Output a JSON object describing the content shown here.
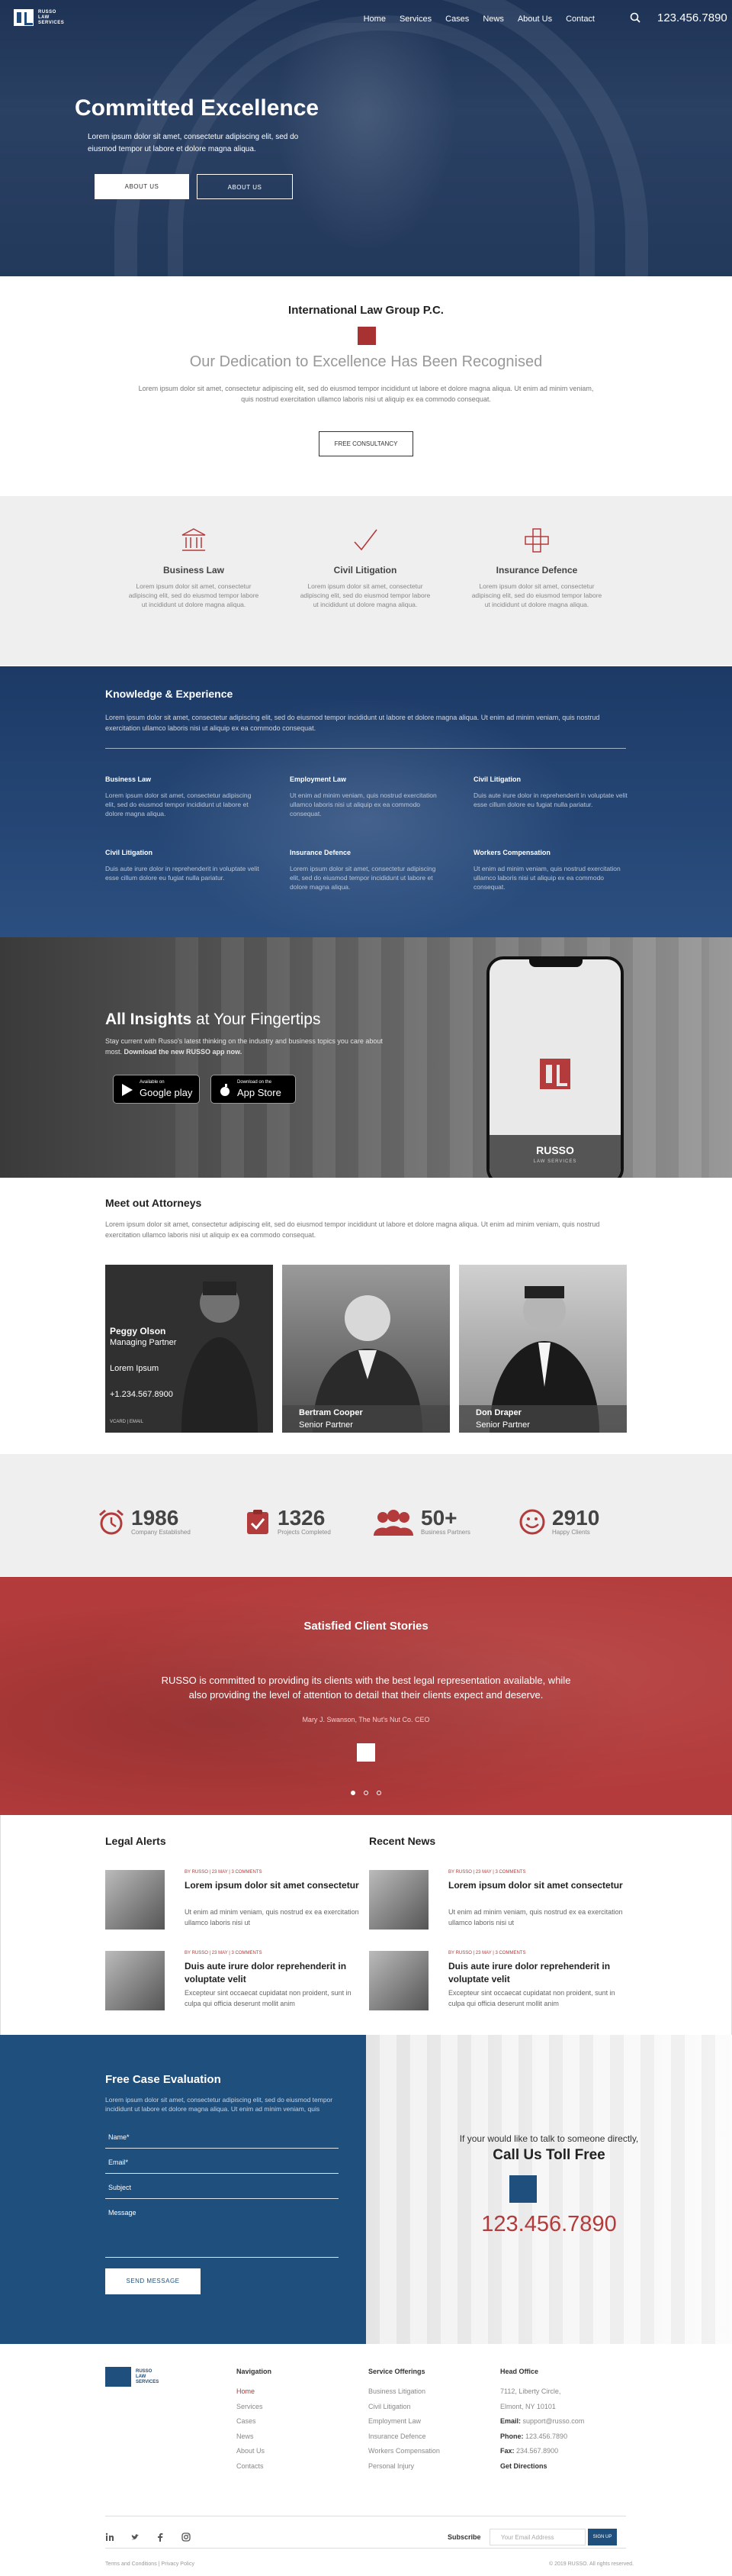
{
  "brand": {
    "logo_text": "RUSSO\nLAW\nSERVICES"
  },
  "nav": {
    "items": [
      "Home",
      "Services",
      "Cases",
      "News",
      "About Us",
      "Contact"
    ],
    "phone": "123.456.7890"
  },
  "hero": {
    "title": "Committed Excellence",
    "subtitle": "Lorem ipsum dolor sit amet, consectetur adipiscing elit, sed do eiusmod tempor ut labore et dolore magna aliqua.",
    "btn_primary": "ABOUT US",
    "btn_secondary": "ABOUT US"
  },
  "intro": {
    "heading": "International Law Group P.C.",
    "title": "Our Dedication to Excellence Has Been Recognised",
    "text": "Lorem ipsum dolor sit amet, consectetur adipiscing elit, sed do eiusmod tempor incididunt ut labore et dolore magna aliqua. Ut enim ad minim veniam, quis nostrud exercitation ullamco laboris nisi ut aliquip ex ea commodo consequat.",
    "button": "FREE CONSULTANCY"
  },
  "practice": [
    {
      "icon": "bank-icon",
      "title": "Business Law",
      "text": "Lorem ipsum dolor sit amet, consectetur adipiscing elit, sed do eiusmod tempor labore ut incididunt ut dolore magna aliqua."
    },
    {
      "icon": "checkmark-icon",
      "title": "Civil Litigation",
      "text": "Lorem ipsum dolor sit amet, consectetur adipiscing elit, sed do eiusmod tempor labore ut incididunt ut dolore magna aliqua."
    },
    {
      "icon": "insurance-cross-icon",
      "title": "Insurance Defence",
      "text": "Lorem ipsum dolor sit amet, consectetur adipiscing elit, sed do eiusmod tempor labore ut incididunt ut dolore magna aliqua."
    }
  ],
  "knowledge": {
    "title": "Knowledge & Experience",
    "desc": "Lorem ipsum dolor sit amet, consectetur adipiscing elit, sed do eiusmod tempor incididunt ut labore et dolore magna aliqua. Ut enim ad minim veniam, quis nostrud exercitation ullamco laboris nisi ut aliquip ex ea commodo consequat.",
    "items": [
      {
        "title": "Business Law",
        "text": "Lorem ipsum dolor sit amet, consectetur adipiscing elit, sed do eiusmod tempor incididunt ut labore et dolore magna aliqua."
      },
      {
        "title": "Employment Law",
        "text": "Ut enim ad minim veniam, quis nostrud exercitation ullamco laboris nisi ut aliquip ex ea commodo consequat."
      },
      {
        "title": "Civil Litigation",
        "text": "Duis aute irure dolor in reprehenderit in voluptate velit esse cillum dolore eu fugiat nulla pariatur."
      },
      {
        "title": "Civil Litigation",
        "text": "Duis aute irure dolor in reprehenderit in voluptate velit esse cillum dolore eu fugiat nulla pariatur."
      },
      {
        "title": "Insurance Defence",
        "text": "Lorem ipsum dolor sit amet, consectetur adipiscing elit, sed do eiusmod tempor incididunt ut labore et dolore magna aliqua."
      },
      {
        "title": "Workers Compensation",
        "text": "Ut enim ad minim veniam, quis nostrud exercitation ullamco laboris nisi ut aliquip ex ea commodo consequat."
      }
    ]
  },
  "app": {
    "title_bold": "All Insights",
    "title_rest": " at Your Fingertips",
    "desc": "Stay current with Russo's latest thinking on the industry and business topics you care about most.",
    "desc_bold": "Download the new RUSSO app now.",
    "google_small": "Available on",
    "google_big": "Google play",
    "apple_small": "Download on the",
    "apple_big": "App Store",
    "phone_name": "RUSSO",
    "phone_sub": "LAW SERVICES"
  },
  "attorneys": {
    "title": "Meet out Attorneys",
    "desc": "Lorem ipsum dolor sit amet, consectetur adipiscing elit, sed do eiusmod tempor incididunt ut labore et dolore magna aliqua. Ut enim ad minim veniam, quis nostrud exercitation ullamco laboris nisi ut aliquip ex ea commodo consequat.",
    "featured": {
      "name": "Peggy Olson",
      "role": "Managing Partner",
      "blurb": "Lorem Ipsum",
      "phone": "+1.234.567.8900",
      "vcard": "VCARD | EMAIL"
    },
    "others": [
      {
        "name": "Bertram Cooper",
        "role": "Senior Partner"
      },
      {
        "name": "Don Draper",
        "role": "Senior Partner"
      }
    ]
  },
  "stats": [
    {
      "icon": "alarm-clock-icon",
      "num": "1986",
      "label": "Company Established"
    },
    {
      "icon": "clipboard-check-icon",
      "num": "1326",
      "label": "Projects Completed"
    },
    {
      "icon": "team-icon",
      "num": "50+",
      "label": "Business Partners"
    },
    {
      "icon": "smiley-icon",
      "num": "2910",
      "label": "Happy Clients"
    }
  ],
  "testimonial": {
    "title": "Satisfied Client Stories",
    "quote": "RUSSO is committed to providing its clients with the best legal representation available, while also providing the level of attention to detail that their clients expect and deserve.",
    "author": "Mary J. Swanson, The Nut's Nut Co. CEO"
  },
  "legal_alerts": {
    "title": "Legal Alerts",
    "items": [
      {
        "meta": "BY RUSSO | 23 MAY | 3 COMMENTS",
        "title": "Lorem ipsum dolor sit amet consectetur",
        "text": "Ut enim ad minim veniam, quis nostrud ex ea exercitation ullamco laboris nisi ut"
      },
      {
        "meta": "BY RUSSO | 23 MAY | 3 COMMENTS",
        "title": "Duis aute irure dolor reprehenderit in voluptate velit",
        "text": "Excepteur sint occaecat cupidatat non proident, sunt in culpa qui officia deserunt mollit anim"
      }
    ]
  },
  "recent_news": {
    "title": "Recent News",
    "items": [
      {
        "meta": "BY RUSSO | 23 MAY | 3 COMMENTS",
        "title": "Lorem ipsum dolor sit amet consectetur",
        "text": "Ut enim ad minim veniam, quis nostrud ex ea exercitation ullamco laboris nisi ut"
      },
      {
        "meta": "BY RUSSO | 23 MAY | 3 COMMENTS",
        "title": "Duis aute irure dolor reprehenderit in voluptate velit",
        "text": "Excepteur sint occaecat cupidatat non proident, sunt in culpa qui officia deserunt mollit anim"
      }
    ]
  },
  "evaluation": {
    "title": "Free Case Evaluation",
    "desc": "Lorem ipsum dolor sit amet, consectetur adipiscing elit, sed do eiusmod tempor incididunt ut labore et dolore magna aliqua. Ut enim ad minim veniam, quis",
    "fields": [
      "Name*",
      "Email*",
      "Subject",
      "Message"
    ],
    "button": "SEND MESSAGE"
  },
  "call": {
    "lead": "If your would like to talk to someone directly,",
    "title": "Call Us Toll Free",
    "phone": "123.456.7890"
  },
  "footer": {
    "navigation": {
      "title": "Navigation",
      "links": [
        "Home",
        "Services",
        "Cases",
        "News",
        "About Us",
        "Contacts"
      ]
    },
    "services": {
      "title": "Service Offerings",
      "links": [
        "Business Litigation",
        "Civil Litigation",
        "Employment Law",
        "Insurance Defence",
        "Workers Compensation",
        "Personal Injury"
      ]
    },
    "office": {
      "title": "Head Office",
      "addr1": "7112, Liberty Circle,",
      "addr2": "Elmont, NY 10101",
      "email_label": "Email:",
      "email": "support@russo.com",
      "phone_label": "Phone:",
      "phone": "123.456.7890",
      "fax_label": "Fax:",
      "fax": "234.567.8900",
      "directions": "Get Directions"
    },
    "subscribe_label": "Subscribe",
    "subscribe_placeholder": "Your Email Address",
    "subscribe_btn": "SIGN UP",
    "legal_left": "Terms and Conditions  |  Privacy Policy",
    "legal_right": "© 2019 RUSSO. All rights reserved."
  }
}
